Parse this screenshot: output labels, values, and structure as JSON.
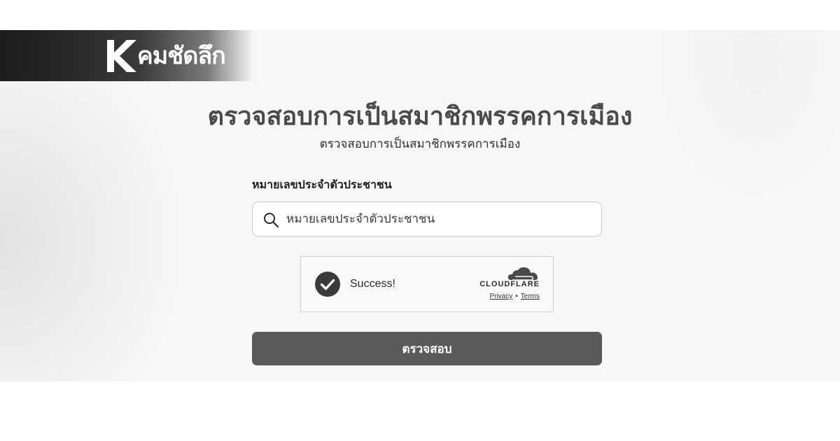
{
  "brand": {
    "logo_text": "คมชัดลึก"
  },
  "header": {
    "title": "ตรวจสอบการเป็นสมาชิกพรรคการเมือง",
    "subtitle": "ตรวจสอบการเป็นสมาชิกพรรคการเมือง"
  },
  "form": {
    "id_label": "หมายเลขประจำตัวประชาชน",
    "id_placeholder": "หมายเลขประจำตัวประชาชน",
    "id_value": "",
    "submit_label": "ตรวจสอบ"
  },
  "captcha": {
    "status_text": "Success!",
    "provider": "CLOUDFLARE",
    "privacy_label": "Privacy",
    "separator": "•",
    "terms_label": "Terms"
  },
  "icons": {
    "search": "search-icon",
    "check": "check-circle-icon",
    "cloud": "cloudflare-cloud-icon",
    "logo": "k-logo-icon"
  },
  "colors": {
    "button": "#5a5a5a",
    "title": "#4a4a4a",
    "check": "#3a3a3a"
  }
}
